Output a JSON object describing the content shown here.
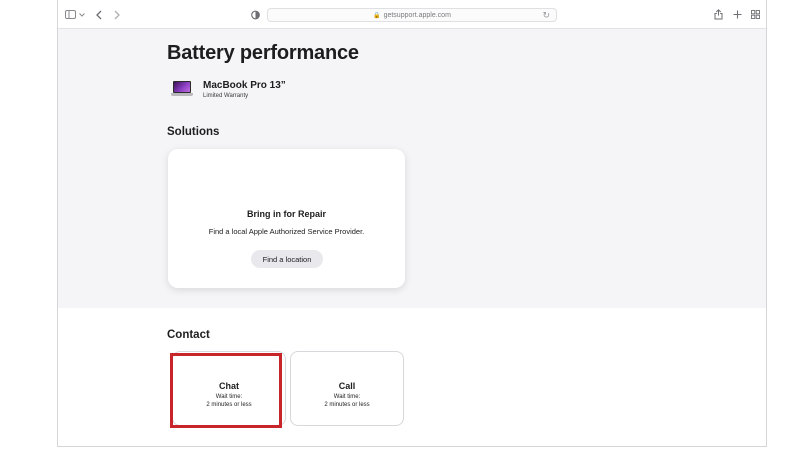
{
  "browser": {
    "url": "getsupport.apple.com",
    "icons": [
      "sidebar-icon",
      "chevron-down-icon",
      "back-icon",
      "forward-icon",
      "privacy-shield-icon",
      "reload-icon",
      "share-icon",
      "new-tab-icon",
      "tab-overview-icon"
    ]
  },
  "page": {
    "title": "Battery performance",
    "product": {
      "name": "MacBook Pro 13”",
      "warranty": "Limited Warranty"
    }
  },
  "solutions": {
    "heading": "Solutions",
    "card": {
      "title": "Bring in for Repair",
      "description": "Find a local Apple Authorized Service Provider.",
      "button_label": "Find a location"
    }
  },
  "contact": {
    "heading": "Contact",
    "options": [
      {
        "title": "Chat",
        "wait_label": "Wait time:",
        "wait_value": "2 minutes or less",
        "highlighted": true
      },
      {
        "title": "Call",
        "wait_label": "Wait time:",
        "wait_value": "2 minutes or less",
        "highlighted": false
      }
    ]
  },
  "colors": {
    "highlight": "#c8252a",
    "page_background": "#f5f5f7",
    "card_background": "#ffffff",
    "button_background": "#e8e8ed"
  }
}
